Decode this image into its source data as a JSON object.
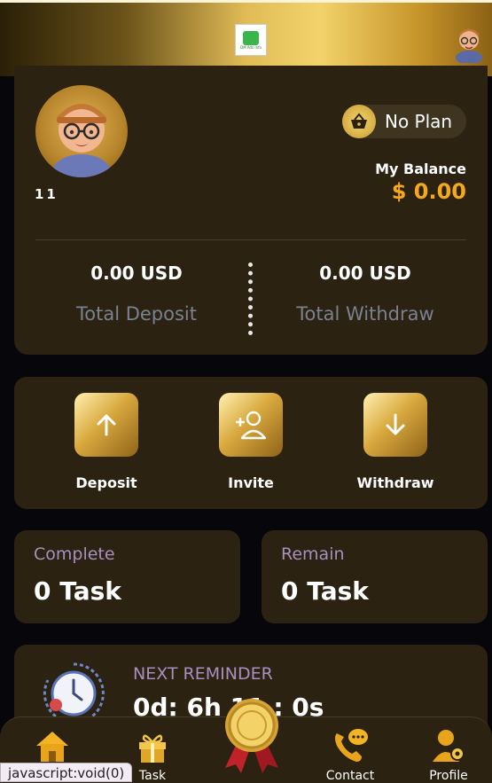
{
  "header": {
    "logo_text": "DM Ads Info",
    "logo_icon": "building-logo-icon",
    "avatar_icon": "user-avatar-icon"
  },
  "profile": {
    "username": "11",
    "plan_label": "No Plan",
    "plan_icon": "shopping-basket-icon",
    "balance_label": "My Balance",
    "balance_value": "$ 0.00",
    "deposit_amount": "0.00 USD",
    "deposit_label": "Total Deposit",
    "withdraw_amount": "0.00 USD",
    "withdraw_label": "Total Withdraw"
  },
  "actions": [
    {
      "label": "Deposit",
      "icon": "arrow-up-icon"
    },
    {
      "label": "Invite",
      "icon": "add-user-icon"
    },
    {
      "label": "Withdraw",
      "icon": "arrow-down-icon"
    }
  ],
  "tasks": {
    "complete_label": "Complete",
    "complete_value": "0 Task",
    "remain_label": "Remain",
    "remain_value": "0 Task"
  },
  "reminder": {
    "title": "NEXT REMINDER",
    "value": "0d: 6h 11 : 0s",
    "icon": "clock-user-icon"
  },
  "nav": [
    {
      "label": "",
      "icon": "home-icon"
    },
    {
      "label": "Task",
      "icon": "gift-icon"
    },
    {
      "label": "",
      "icon": "medal-icon"
    },
    {
      "label": "Contact",
      "icon": "phone-chat-icon"
    },
    {
      "label": "Profile",
      "icon": "profile-settings-icon"
    }
  ],
  "status_url": "javascript:void(0)",
  "colors": {
    "accent": "#f5a81c",
    "card": "#2b2212",
    "muted": "#7a8190",
    "lavender": "#a98ec0"
  }
}
